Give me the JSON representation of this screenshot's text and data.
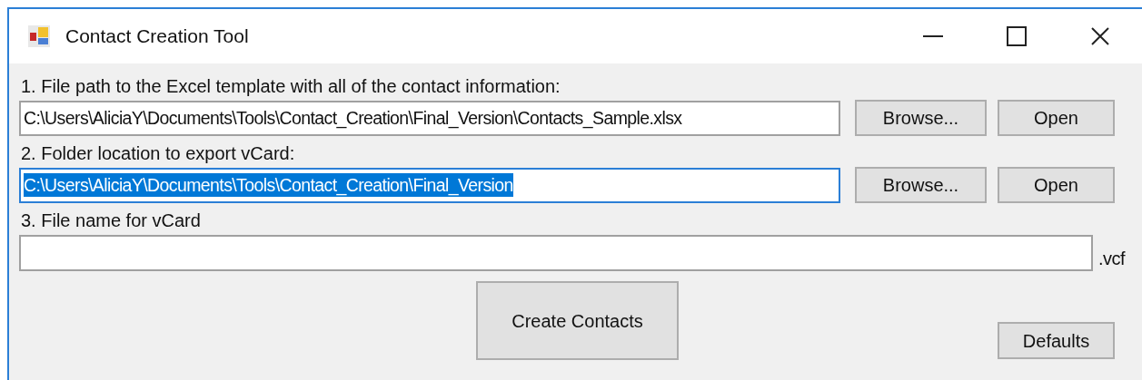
{
  "window": {
    "title": "Contact Creation Tool"
  },
  "fields": [
    {
      "label": "1. File path to the Excel template with all of the contact information:",
      "value": "C:\\Users\\AliciaY\\Documents\\Tools\\Contact_Creation\\Final_Version\\Contacts_Sample.xlsx",
      "focused": false,
      "buttons": [
        "Browse...",
        "Open"
      ]
    },
    {
      "label": "2. Folder location to export vCard:",
      "value": "C:\\Users\\AliciaY\\Documents\\Tools\\Contact_Creation\\Final_Version",
      "focused": true,
      "buttons": [
        "Browse...",
        "Open"
      ]
    },
    {
      "label": "3. File name for vCard",
      "focused": false,
      "suffix": ".vcf"
    }
  ],
  "create_button": "Create Contacts",
  "defaults_button": "Defaults"
}
